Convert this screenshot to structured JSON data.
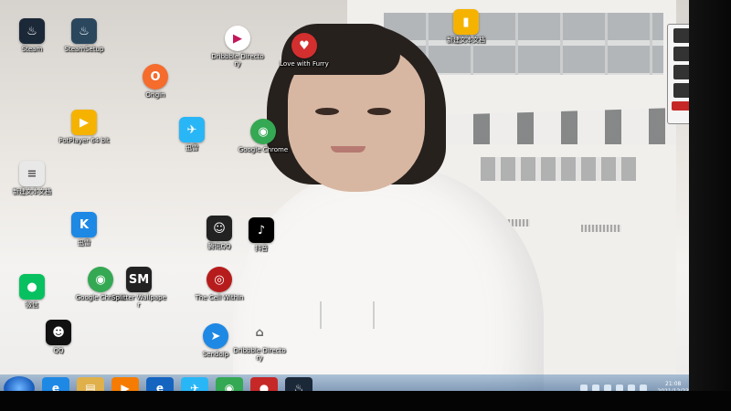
{
  "desktop": {
    "icons": [
      {
        "label": "Steam",
        "icon": "steam-icon",
        "color": "#1b2838"
      },
      {
        "label": "SteamSetup",
        "icon": "steam-setup-icon",
        "color": "#2a475e"
      },
      {
        "label": "Love with Furry",
        "icon": "game-heart-icon",
        "color": "#d32f2f"
      },
      {
        "label": "Origin",
        "icon": "origin-icon",
        "color": "#f56c2d"
      },
      {
        "label": "PotPlayer 64 bit",
        "icon": "potplayer-icon",
        "color": "#f5b300"
      },
      {
        "label": "Google Chrome",
        "icon": "chrome-icon",
        "color": "#34a853"
      },
      {
        "label": "微信",
        "icon": "wechat-icon",
        "color": "#07c160"
      },
      {
        "label": "QQ",
        "icon": "qq-icon",
        "color": "#111111"
      },
      {
        "label": "Splitter Wallpaper",
        "icon": "sm-icon",
        "color": "#222222"
      },
      {
        "label": "The Cell Within",
        "icon": "eye-game-icon",
        "color": "#b71c1c"
      },
      {
        "label": "Dribbble Directory",
        "icon": "folder-icon",
        "color": "#cccccc"
      },
      {
        "label": "迅雷",
        "icon": "thunder-icon",
        "color": "#1e88e5"
      },
      {
        "label": "抖音",
        "icon": "tiktok-icon",
        "color": "#000000"
      },
      {
        "label": "腾讯QQ",
        "icon": "penguin-icon",
        "color": "#222222"
      },
      {
        "label": "新建文本文档",
        "icon": "text-file-icon",
        "color": "#e8e8e8"
      },
      {
        "label": "Sendoip",
        "icon": "send-icon",
        "color": "#1e88e5"
      }
    ]
  },
  "taskbar": {
    "items": [
      {
        "icon": "ie-icon",
        "color": "#1e88e5",
        "glyph": "e"
      },
      {
        "icon": "explorer-icon",
        "color": "#e0b04a",
        "glyph": "▤"
      },
      {
        "icon": "media-icon",
        "color": "#f57c00",
        "glyph": "▶"
      },
      {
        "icon": "ie2-icon",
        "color": "#1565c0",
        "glyph": "e"
      },
      {
        "icon": "feishu-icon",
        "color": "#29b6f6",
        "glyph": "✈"
      },
      {
        "icon": "chrome-task-icon",
        "color": "#34a853",
        "glyph": "◉"
      },
      {
        "icon": "game-task-icon",
        "color": "#c62828",
        "glyph": "●"
      },
      {
        "icon": "steam-task-icon",
        "color": "#1b2838",
        "glyph": "♨"
      }
    ],
    "clock": {
      "time": "21:08",
      "date": "2021/12/23"
    }
  },
  "colors": {
    "taskbar": "#4f78a6",
    "start": "#1b5fbf"
  }
}
